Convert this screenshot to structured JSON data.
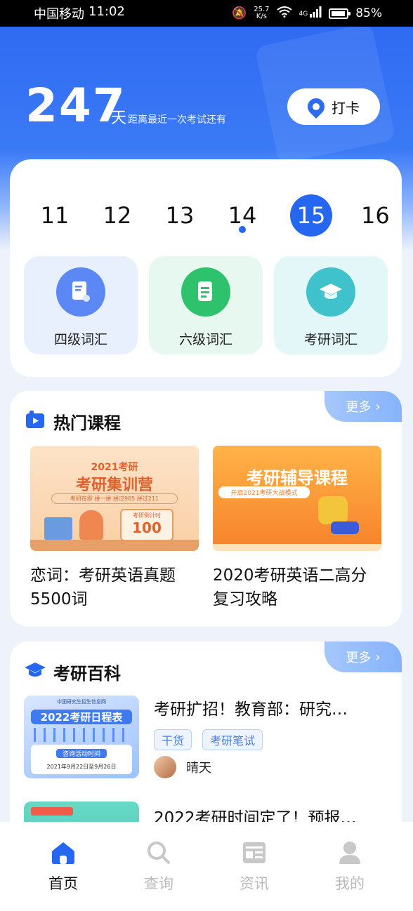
{
  "status_bar": {
    "carrier": "中国移动",
    "time": "11:02",
    "speed_value": "25.7",
    "speed_unit": "K/s",
    "network": "4G",
    "battery": "85%"
  },
  "hero": {
    "days": "247",
    "unit": "天",
    "description": "距离最近一次考试还有",
    "checkin_label": "打卡"
  },
  "dates": {
    "items": [
      "11",
      "12",
      "13",
      "14",
      "15",
      "16"
    ],
    "selected": "15",
    "marked": "14"
  },
  "vocab": [
    {
      "label": "四级词汇",
      "icon": "doc-icon",
      "color": "#5b88f4",
      "bg": "#e8f0fd"
    },
    {
      "label": "六级词汇",
      "icon": "file-icon",
      "color": "#2dc26b",
      "bg": "#e6f8ef"
    },
    {
      "label": "考研词汇",
      "icon": "grad-cap-icon",
      "color": "#3fc2cc",
      "bg": "#e3f7f8"
    }
  ],
  "hot_courses": {
    "title": "热门课程",
    "more": "更多",
    "items": [
      {
        "title": "恋词：考研英语真题5500词",
        "image_text": {
          "line1": "2021考研",
          "line2": "考研集训营",
          "line3": "考研在即 拼一拼 拼过985 拼过211",
          "badge": "考研倒计时",
          "count": "100"
        }
      },
      {
        "title": "2020考研英语二高分复习攻略",
        "image_text": {
          "line1": "考研辅导课程",
          "line2": "开启2021考研大战模式"
        }
      }
    ]
  },
  "encyclopedia": {
    "title": "考研百科",
    "more": "更多",
    "articles": [
      {
        "title": "考研扩招！教育部：研究…",
        "tags": [
          "干货",
          "考研笔试"
        ],
        "author": "晴天",
        "thumb_text": {
          "org": "中国研究生招生信息网",
          "heading": "2022考研日程表",
          "label": "咨询活动时间",
          "dates": "2021年9月22日至9月26日"
        }
      },
      {
        "title": "2022考研时间定了！预报…"
      }
    ]
  },
  "bottom_nav": [
    {
      "label": "首页",
      "icon": "home-icon",
      "active": true
    },
    {
      "label": "查询",
      "icon": "search-icon",
      "active": false
    },
    {
      "label": "资讯",
      "icon": "news-icon",
      "active": false
    },
    {
      "label": "我的",
      "icon": "user-icon",
      "active": false
    }
  ],
  "colors": {
    "primary": "#2567f0",
    "hero_top": "#2f6bf2"
  }
}
